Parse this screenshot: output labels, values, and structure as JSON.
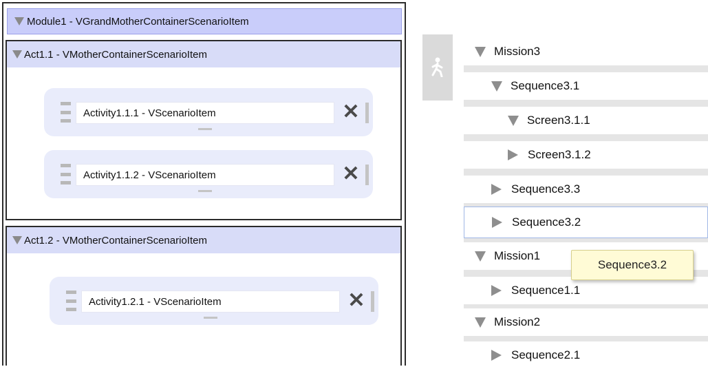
{
  "scenario": {
    "module_label": "Module1 - VGrandMotherContainerScenarioItem",
    "acts": [
      {
        "label": "Act1.1 - VMotherContainerScenarioItem",
        "activities": [
          {
            "label": "Activity1.1.1 - VScenarioItem"
          },
          {
            "label": "Activity1.1.2 - VScenarioItem"
          }
        ]
      },
      {
        "label": "Act1.2 - VMotherContainerScenarioItem",
        "activities": [
          {
            "label": "Activity1.2.1 - VScenarioItem"
          }
        ]
      }
    ],
    "remove_glyph": "✕"
  },
  "tree": {
    "items": [
      {
        "label": "Mission3",
        "expanded": true
      },
      {
        "label": "Sequence3.1",
        "expanded": true
      },
      {
        "label": "Screen3.1.1",
        "expanded": true
      },
      {
        "label": "Screen3.1.2",
        "expanded": false
      },
      {
        "label": "Sequence3.3",
        "expanded": false
      },
      {
        "label": "Sequence3.2",
        "expanded": false,
        "selected": true
      },
      {
        "label": "Mission1",
        "expanded": true
      },
      {
        "label": "Sequence1.1",
        "expanded": false
      },
      {
        "label": "Mission2",
        "expanded": true
      },
      {
        "label": "Sequence2.1",
        "expanded": false
      }
    ],
    "tooltip": "Sequence3.2"
  },
  "toolbox": {
    "icon": "running-person-icon"
  },
  "colors": {
    "module_header_bg": "#c9cdfa",
    "act_header_bg": "#d8dcf8",
    "activity_bg": "#e9ecfb",
    "tree_separator": "#e5e5e5",
    "tooltip_bg": "#fffbd6",
    "selection_border": "#9fb7e6"
  }
}
